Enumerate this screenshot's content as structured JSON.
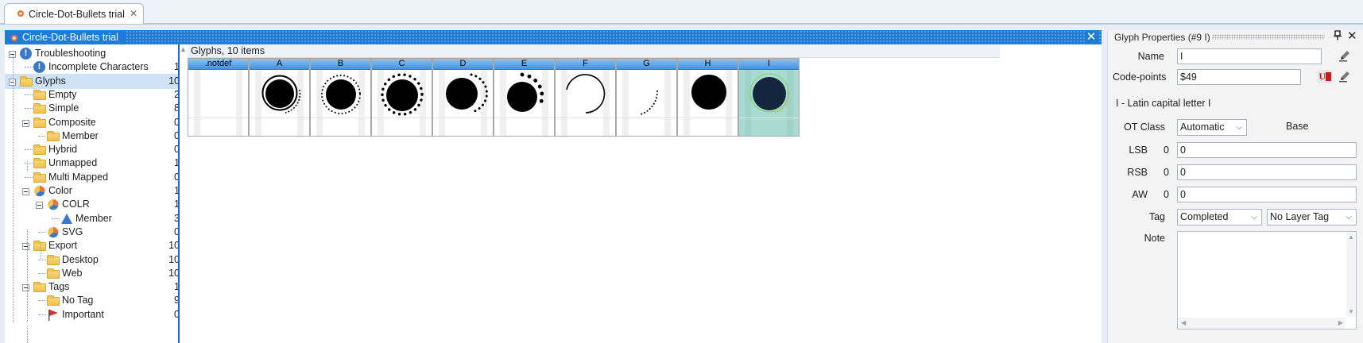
{
  "document_tab": {
    "title": "Circle-Dot-Bullets trial",
    "close_glyph": "✕"
  },
  "window": {
    "title": "Circle-Dot-Bullets trial",
    "close_glyph": "✕"
  },
  "tree": {
    "items": [
      {
        "label": "Troubleshooting",
        "count": "",
        "icon": "warning-icon"
      },
      {
        "label": "Incomplete Characters",
        "count": "1",
        "icon": "warning-icon"
      },
      {
        "label": "Glyphs",
        "count": "10",
        "icon": "folder-icon"
      },
      {
        "label": "Empty",
        "count": "2",
        "icon": "folder-icon"
      },
      {
        "label": "Simple",
        "count": "8",
        "icon": "folder-icon"
      },
      {
        "label": "Composite",
        "count": "0",
        "icon": "folder-icon"
      },
      {
        "label": "Member",
        "count": "0",
        "icon": "folder-icon"
      },
      {
        "label": "Hybrid",
        "count": "0",
        "icon": "folder-icon"
      },
      {
        "label": "Unmapped",
        "count": "1",
        "icon": "folder-icon"
      },
      {
        "label": "Multi Mapped",
        "count": "0",
        "icon": "folder-icon"
      },
      {
        "label": "Color",
        "count": "1",
        "icon": "color-pie-icon"
      },
      {
        "label": "COLR",
        "count": "1",
        "icon": "color-pie-icon"
      },
      {
        "label": "Member",
        "count": "3",
        "icon": "triangle-icon"
      },
      {
        "label": "SVG",
        "count": "0",
        "icon": "color-pie-icon"
      },
      {
        "label": "Export",
        "count": "10",
        "icon": "folder-icon"
      },
      {
        "label": "Desktop",
        "count": "10",
        "icon": "folder-icon"
      },
      {
        "label": "Web",
        "count": "10",
        "icon": "folder-icon"
      },
      {
        "label": "Tags",
        "count": "1",
        "icon": "folder-icon"
      },
      {
        "label": "No Tag",
        "count": "9",
        "icon": "folder-icon"
      },
      {
        "label": "Important",
        "count": "0",
        "icon": "flag-icon"
      }
    ]
  },
  "glyphs": {
    "header": "Glyphs, 10 items",
    "cells": [
      {
        "name": ".notdef",
        "shape": "empty"
      },
      {
        "name": "A",
        "shape": "disc-with-ring-arc"
      },
      {
        "name": "B",
        "shape": "disc-with-dotted-ring"
      },
      {
        "name": "C",
        "shape": "disc-with-dot-ring"
      },
      {
        "name": "D",
        "shape": "disc-with-partial-dots"
      },
      {
        "name": "E",
        "shape": "disc-with-large-dots"
      },
      {
        "name": "F",
        "shape": "arc-outline"
      },
      {
        "name": "G",
        "shape": "dotted-arc"
      },
      {
        "name": "H",
        "shape": "disc"
      },
      {
        "name": "I",
        "shape": "dark-disc-selected"
      }
    ],
    "selected": "I"
  },
  "properties": {
    "title": "Glyph Properties (#9 I)",
    "pin_glyph": "📌",
    "close_glyph": "✕",
    "name_label": "Name",
    "name_value": "I",
    "codepoints_label": "Code-points",
    "codepoints_value": "$49",
    "unicode_description": "I - Latin capital letter I",
    "otclass_label": "OT Class",
    "otclass_value": "Automatic",
    "base_label": "Base",
    "lsb_label": "LSB",
    "lsb_current": "0",
    "lsb_value": "0",
    "rsb_label": "RSB",
    "rsb_current": "0",
    "rsb_value": "0",
    "aw_label": "AW",
    "aw_current": "0",
    "aw_value": "0",
    "tag_label": "Tag",
    "tag_value": "Completed",
    "layer_tag_value": "No Layer Tag",
    "note_label": "Note",
    "note_value": ""
  },
  "colors": {
    "accent": "#1e7bd6",
    "selection": "#cfe3f7",
    "glyph_selected_bg": "#a8dcd2",
    "glyph_selected_fill": "#13263d"
  }
}
